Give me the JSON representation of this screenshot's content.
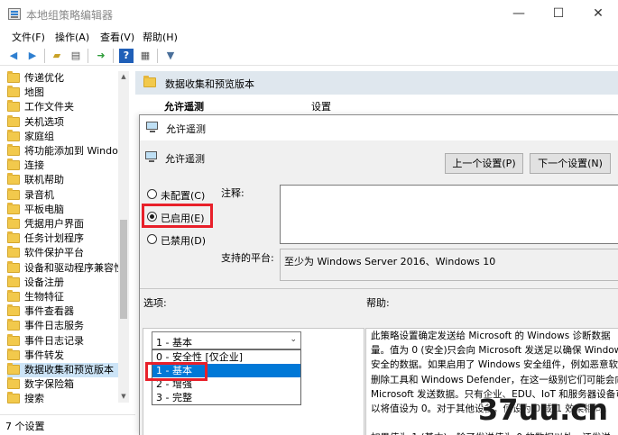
{
  "window": {
    "title": "本地组策略编辑器",
    "minimize": "—",
    "maximize": "☐",
    "close": "✕"
  },
  "menu": [
    "文件(F)",
    "操作(A)",
    "查看(V)",
    "帮助(H)"
  ],
  "tree": {
    "items": [
      "传递优化",
      "地图",
      "工作文件夹",
      "关机选项",
      "家庭组",
      "将功能添加到 Windows",
      "连接",
      "联机帮助",
      "录音机",
      "平板电脑",
      "凭据用户界面",
      "任务计划程序",
      "软件保护平台",
      "设备和驱动程序兼容性",
      "设备注册",
      "生物特征",
      "事件查看器",
      "事件日志服务",
      "事件日志记录",
      "事件转发",
      "数据收集和预览版本",
      "数字保险箱",
      "搜索"
    ],
    "selected_index": 20
  },
  "status": {
    "text": "7 个设置"
  },
  "content": {
    "header": "数据收集和预览版本",
    "policy_name": "允许遥测",
    "column_setting": "设置"
  },
  "dialog": {
    "title": "允许遥测",
    "subtitle": "允许遥测",
    "prev_button": "上一个设置(P)",
    "next_button": "下一个设置(N)",
    "radios": [
      {
        "label": "未配置(C)",
        "checked": false
      },
      {
        "label": "已启用(E)",
        "checked": true
      },
      {
        "label": "已禁用(D)",
        "checked": false
      }
    ],
    "comment_label": "注释:",
    "platform_label": "支持的平台:",
    "platform_value": "至少为 Windows Server 2016、Windows 10",
    "options_label": "选项:",
    "help_label": "帮助:",
    "select_value": "1 - 基本",
    "dropdown_options": [
      "0 - 安全性 [仅企业]",
      "1 - 基本",
      "2 - 增强",
      "3 - 完整"
    ],
    "dropdown_selected_index": 1,
    "help_text": "此策略设置确定发送给 Microsoft 的 Windows 诊断数据量。值为 0 (安全)只会向 Microsoft 发送足以确保 Windows 安全的数据。如果启用了 Windows 安全组件，例如恶意软件删除工具和 Windows Defender，在这一级别它们可能会向 Microsoft 发送数据。只有企业、EDU、IoT 和服务器设备可以将值设为 0。对于其他设备，值设为 0 或 1 效果相同。\n\n如果值为 1 (基本)，除了发送值为 0 的数据以外，还发送"
  },
  "watermark": "37uu.cn",
  "colors": {
    "highlight_box": "#e8202a",
    "selection": "#0078d7",
    "tree_selection": "#cce4f7"
  }
}
